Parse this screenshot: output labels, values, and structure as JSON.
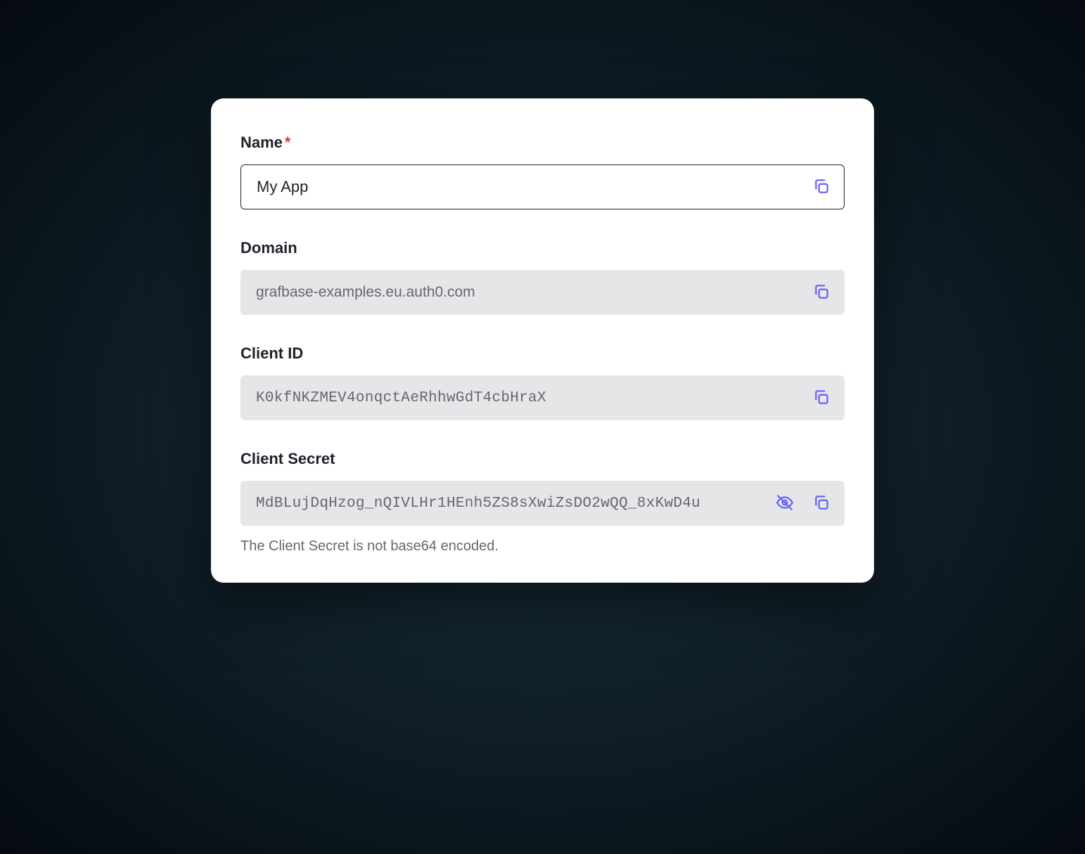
{
  "fields": {
    "name": {
      "label": "Name",
      "required_mark": "*",
      "value": "My App"
    },
    "domain": {
      "label": "Domain",
      "value": "grafbase-examples.eu.auth0.com"
    },
    "client_id": {
      "label": "Client ID",
      "value": "K0kfNKZMEV4onqctAeRhhwGdT4cbHraX"
    },
    "client_secret": {
      "label": "Client Secret",
      "value": "MdBLujDqHzog_nQIVLHr1HEnh5ZS8sXwiZsDO2wQQ_8xKwD4u",
      "helper": "The Client Secret is not base64 encoded."
    }
  },
  "colors": {
    "accent": "#635dff",
    "required": "#e53935"
  }
}
